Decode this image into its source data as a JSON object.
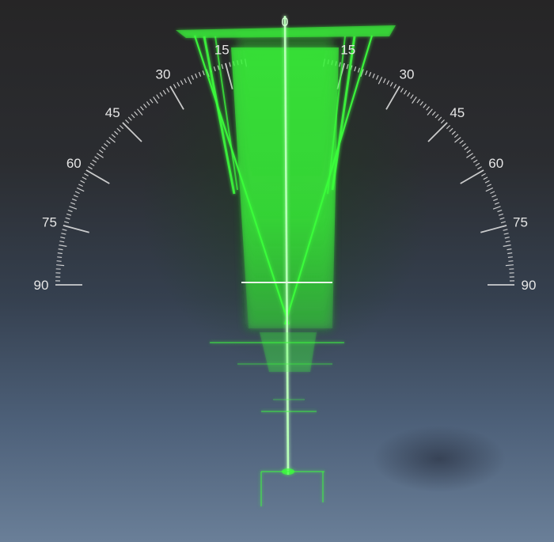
{
  "display": {
    "center_marker": "0",
    "scale_left": [
      {
        "angle": 15,
        "label": "15"
      },
      {
        "angle": 30,
        "label": "30"
      },
      {
        "angle": 45,
        "label": "45"
      },
      {
        "angle": 60,
        "label": "60"
      },
      {
        "angle": 75,
        "label": "75"
      },
      {
        "angle": 90,
        "label": "90"
      }
    ],
    "scale_right": [
      {
        "angle": 15,
        "label": "15"
      },
      {
        "angle": 30,
        "label": "30"
      },
      {
        "angle": 45,
        "label": "45"
      },
      {
        "angle": 60,
        "label": "60"
      },
      {
        "angle": 75,
        "label": "75"
      },
      {
        "angle": 90,
        "label": "90"
      }
    ],
    "trace_color": "#3cff3c",
    "scale_color": "#e6e6e6"
  }
}
